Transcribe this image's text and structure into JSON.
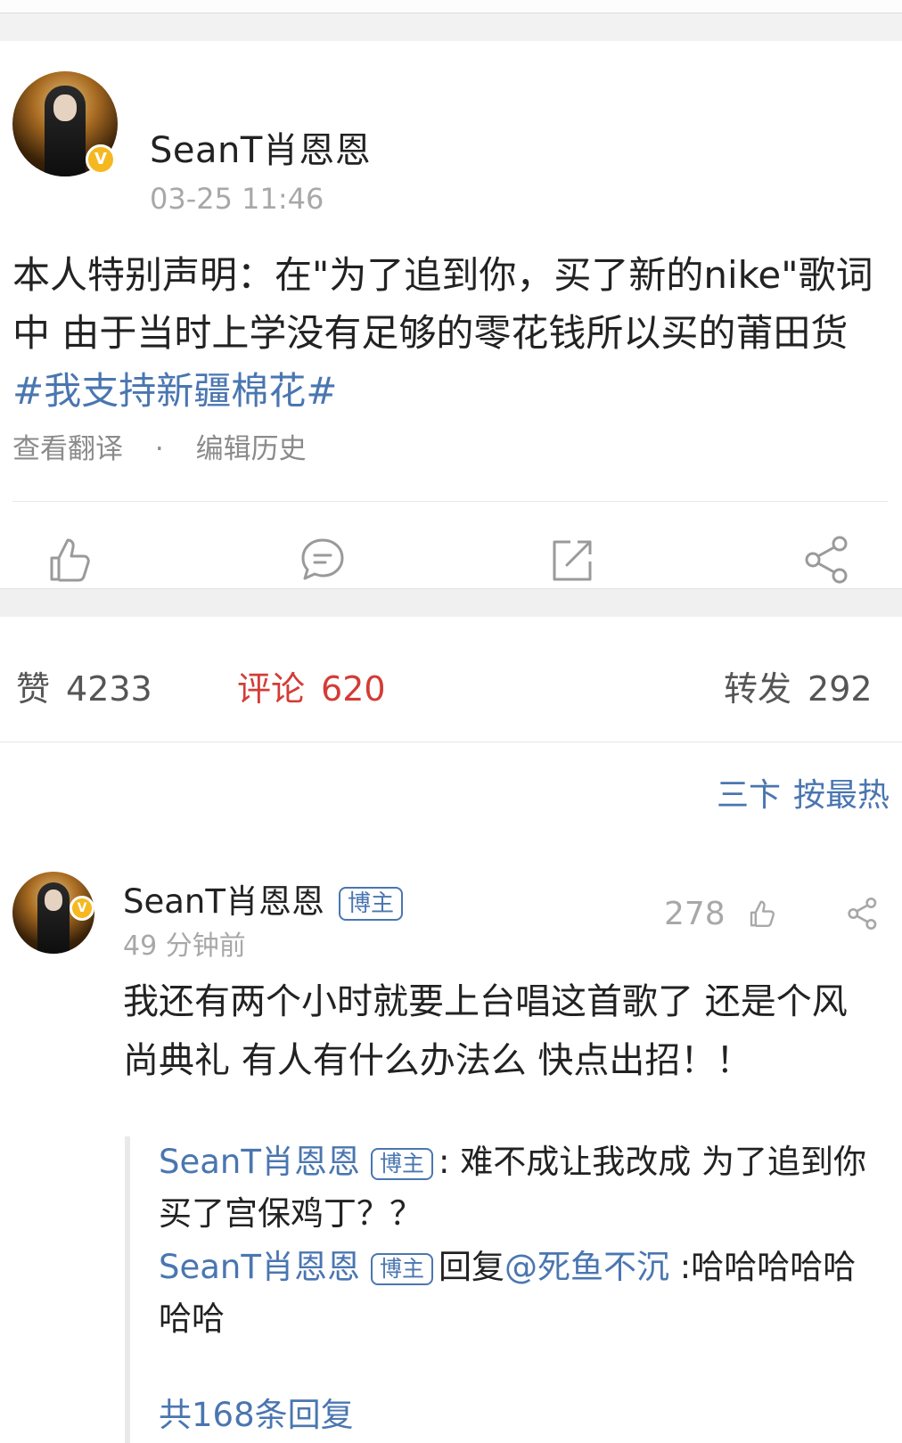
{
  "post": {
    "author": "SeanT肖恩恩",
    "time": "03-25 11:46",
    "text": "本人特别声明：在\"为了追到你，买了新的nike\"歌词中 由于当时上学没有足够的零花钱所以买的莆田货 ",
    "hashtag": "#我支持新疆棉花#",
    "meta_translate": "查看翻译",
    "meta_dot": "·",
    "meta_history": "编辑历史",
    "verified_badge": "V"
  },
  "actions": {
    "like_icon": "thumbs-up-icon",
    "comment_icon": "comment-icon",
    "repost_icon": "repost-icon",
    "share_icon": "share-icon"
  },
  "stats": {
    "likes_label": "赞",
    "likes_count": "4233",
    "comments_label": "评论",
    "comments_count": "620",
    "reposts_label": "转发",
    "reposts_count": "292"
  },
  "sort": {
    "icon": "三卞",
    "label": "按最热"
  },
  "comment": {
    "author": "SeanT肖恩恩",
    "tag": "博主",
    "time": "49 分钟前",
    "likes": "278",
    "text": "我还有两个小时就要上台唱这首歌了 还是个风尚典礼 有人有什么办法么 快点出招！！",
    "verified_badge": "V"
  },
  "replies": [
    {
      "author": "SeanT肖恩恩",
      "tag": "博主",
      "text": ": 难不成让我改成 为了追到你 买了宫保鸡丁？？"
    },
    {
      "author": "SeanT肖恩恩",
      "tag": "博主",
      "reply_word": "回复",
      "mention": "@死鱼不沉",
      "text": " :哈哈哈哈哈哈哈"
    }
  ],
  "more_replies": "共168条回复",
  "colors": {
    "link_blue": "#4a76b0",
    "active_red": "#d33c36",
    "gray_text": "#a8a8a8",
    "verified_gold": "#f5b820"
  }
}
